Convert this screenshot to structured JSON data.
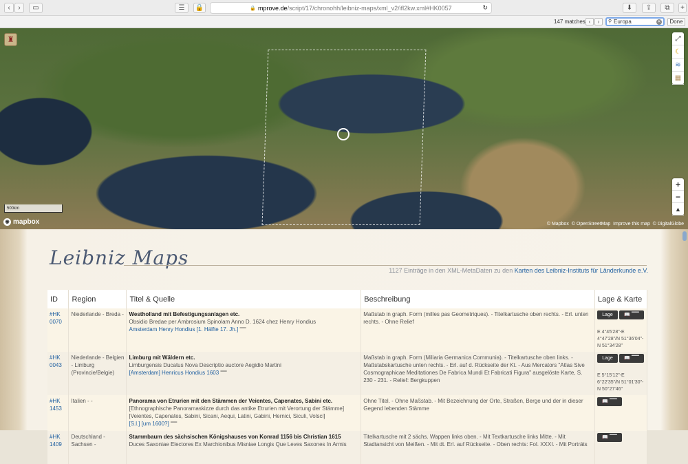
{
  "browser": {
    "url_domain": "mprove.de",
    "url_path": "/script/17/chronohh/leibniz-maps/xml_v2/ifl2kw.xml#HK0057",
    "find": {
      "matches": "147 matches",
      "query": "Europa",
      "done_label": "Done"
    }
  },
  "map": {
    "scale_label": "500km",
    "logo_text": "mapbox",
    "attribution": "© Mapbox  © OpenStreetMap  Improve this map  © DigitalGlobe",
    "zoom_in": "+",
    "zoom_out": "−"
  },
  "page": {
    "title": "Leibniz Maps",
    "subtitle_prefix": "1127 Einträge in den XML-MetaDaten zu den ",
    "subtitle_link": "Karten des Leibniz-Instituts für Länderkunde e.V.",
    "columns": [
      "ID",
      "Region",
      "Titel & Quelle",
      "Beschreibung",
      "Lage & Karte"
    ],
    "lage_label": "Lage",
    "rows": [
      {
        "id": "#HK 0070",
        "region": "Niederlande - Breda -",
        "title": "Westholland mit Befestigungsanlagen etc.",
        "source": "Obsidio Bredae per Ambrosium Spinolam Anno D. 1624 chez Henry Hondius",
        "link": "Amsterdam Henry Hondius [1. Hälfte 17. Jh.]",
        "description": "Maßstab in graph. Form (milles pas Geometriques). - Titelkartusche oben rechts. - Erl. unten rechts. - Ohne Relief",
        "has_lage": true,
        "coords": "E 4°45'28\"-E 4°47'28\"/N 51°36'04\"-N 51°34'28\""
      },
      {
        "id": "#HK 0043",
        "region": "Niederlande - Belgien - Limburg (Provincie/Belgie)",
        "title": "Limburg mit Wäldern etc.",
        "source": "Limburgensis Ducatus Nova Descriptio auctore Aegidio Martini",
        "link": "[Amsterdam] Henricus Hondius 1603",
        "description": "Maßstab in graph. Form (Miliaria Germanica Communia). - Titelkartusche oben links. - Maßstabskartusche unten rechts. - Erl. auf d. Rückseite der Kt. - Aus Mercators \"Atlas Sive Cosmographicae Meditationes De Fabrica Mundi Et Fabricati Figura\" ausgelöste Karte, S. 230 - 231. - Relief: Bergkuppen",
        "has_lage": true,
        "coords": "E 5°15'12\"-E 6°22'35\"/N 51°01'30\"-N 50°27'46\""
      },
      {
        "id": "#HK 1453",
        "region": "Italien - -",
        "title": "Panorama von Etrurien mit den Stämmen der Veientes, Capenates, Sabini etc.",
        "source": "[Ethnographische Panoramaskizze durch das antike Etrurien mit Verortung der Stämme] [Veientes, Capenates, Sabini, Sicani, Aequi, Latini, Gabini, Hernici, Siculi, Volsci]",
        "link": "[S.l.] [um 1600?]",
        "description": "Ohne Titel. - Ohne Maßstab. - Mit Bezeichnung der Orte, Straßen, Berge und der in dieser Gegend lebenden Stämme",
        "has_lage": false,
        "coords": ""
      },
      {
        "id": "#HK 1409",
        "region": "Deutschland - Sachsen -",
        "title": "Stammbaum des sächsischen Königshauses von Konrad 1156 bis Christian 1615",
        "source": "Duces Saxoniae Electores Ex Marchionibus Misniae Longis Que Leves Saxones In Armis",
        "link": "",
        "description": "Titelkartusche mit 2 sächs. Wappen links oben. - Mit Textkartusche links Mitte. - Mit Stadtansicht von Meißen. - Mit dt. Erl. auf Rückseite. - Oben rechts: Fol. XXXI. - Mit Porträts",
        "has_lage": false,
        "coords": ""
      }
    ]
  }
}
